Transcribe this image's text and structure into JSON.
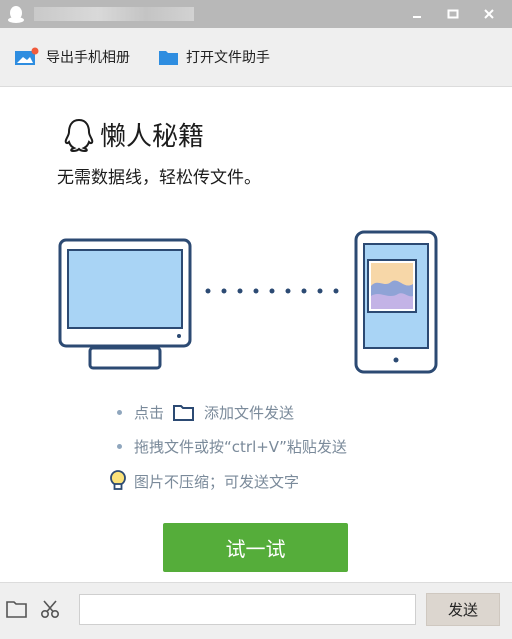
{
  "toolbar": {
    "export_album_label": "导出手机相册",
    "file_assistant_label": "打开文件助手"
  },
  "hero": {
    "title": "懒人秘籍",
    "subtitle": "无需数据线，轻松传文件。"
  },
  "tips": {
    "tip1_prefix": "点击",
    "tip1_suffix": "添加文件发送",
    "tip2": "拖拽文件或按“ctrl+V”粘贴发送",
    "tip3": "图片不压缩；可发送文字"
  },
  "try_button_label": "试一试",
  "composer": {
    "input_value": "",
    "send_label": "发送"
  },
  "colors": {
    "accent_green": "#55ad3a",
    "illustration_blue": "#2c4a73",
    "screen_blue": "#a9d4f5"
  }
}
